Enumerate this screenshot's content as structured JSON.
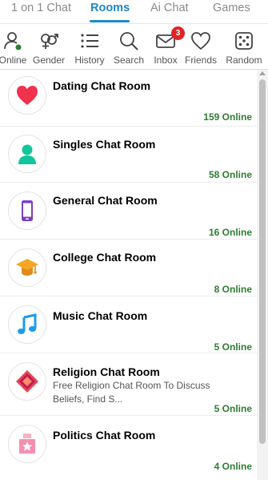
{
  "top_tabs": [
    {
      "label": "1 on 1 Chat"
    },
    {
      "label": "Rooms"
    },
    {
      "label": "Ai Chat"
    },
    {
      "label": "Games"
    }
  ],
  "active_tab": "Rooms",
  "toolbar": {
    "items": [
      {
        "label": "Online",
        "icon": "user-online-icon"
      },
      {
        "label": "Gender",
        "icon": "gender-icon"
      },
      {
        "label": "History",
        "icon": "history-list-icon"
      },
      {
        "label": "Search",
        "icon": "search-icon"
      },
      {
        "label": "Inbox",
        "icon": "mail-icon",
        "badge": "3"
      },
      {
        "label": "Friends",
        "icon": "heart-icon"
      },
      {
        "label": "Random",
        "icon": "dice-icon"
      }
    ]
  },
  "rooms": [
    {
      "title": "Dating Chat Room",
      "online": "159 Online",
      "icon": "heart-icon"
    },
    {
      "title": "Singles Chat Room",
      "online": "58 Online",
      "icon": "person-icon"
    },
    {
      "title": "General Chat Room",
      "online": "16 Online",
      "icon": "phone-icon"
    },
    {
      "title": "College Chat Room",
      "online": "8 Online",
      "icon": "graduation-cap-icon"
    },
    {
      "title": "Music Chat Room",
      "online": "5 Online",
      "icon": "music-note-icon"
    },
    {
      "title": "Religion Chat Room",
      "description": "Free Religion Chat Room To Discuss Beliefs, Find S...",
      "online": "5 Online",
      "icon": "religion-emblem-icon"
    },
    {
      "title": "Politics Chat Room",
      "online": "4 Online",
      "icon": "politics-badge-icon"
    }
  ],
  "colors": {
    "accent": "#1e88c9",
    "online_text": "#2e7d32",
    "badge": "#e02424"
  }
}
